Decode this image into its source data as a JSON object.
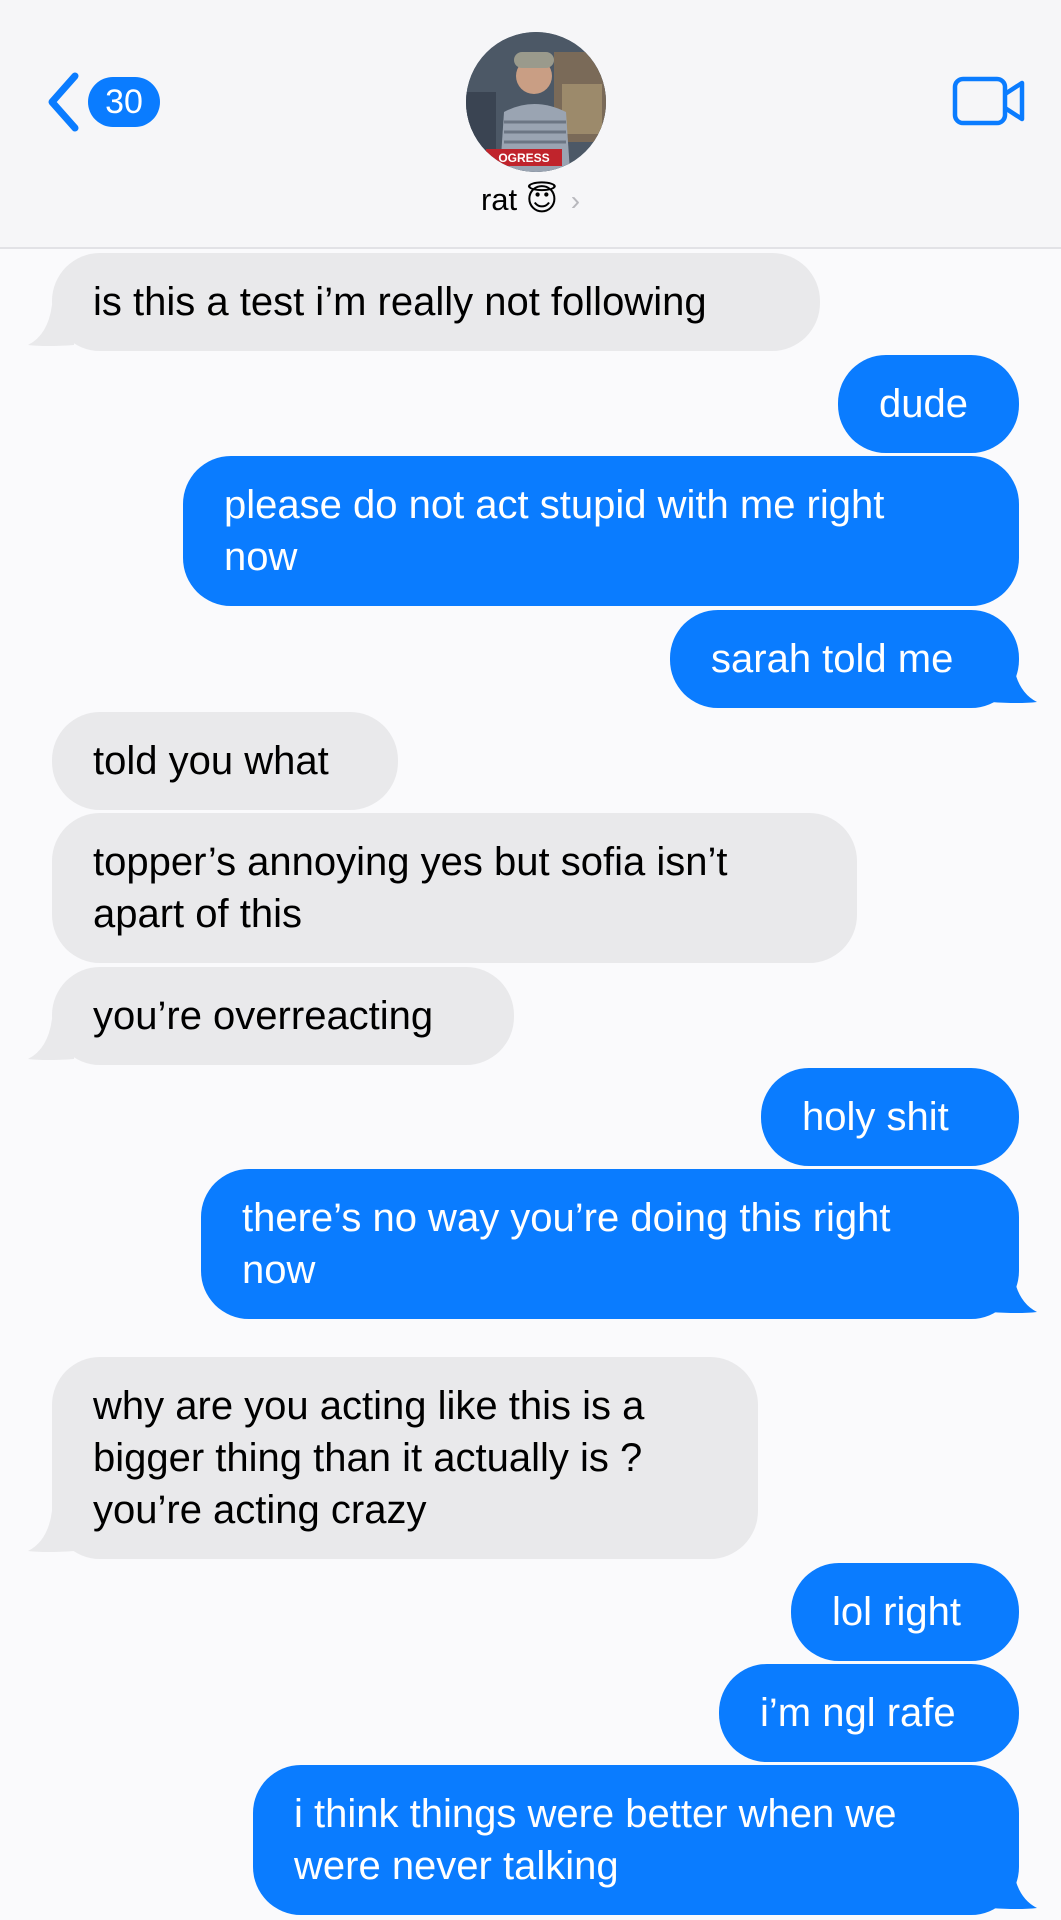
{
  "header": {
    "back_count": "30",
    "contact_name": "rat",
    "contact_emoji": "😇",
    "chevron": "›",
    "avatar_sign_text": "OGRESS",
    "back_icon": "chevron-left-icon",
    "video_icon": "video-camera-icon"
  },
  "colors": {
    "accent": "#0a7cff",
    "incoming_bubble": "#e9e9eb",
    "background": "#fafafc"
  },
  "messages": [
    {
      "from": "them",
      "lines": [
        "is this a test i’m really not following"
      ]
    },
    {
      "from": "me",
      "lines": [
        "dude"
      ]
    },
    {
      "from": "me",
      "lines": [
        "please do not act stupid with me right",
        "now"
      ]
    },
    {
      "from": "me",
      "lines": [
        "sarah told me"
      ]
    },
    {
      "from": "them",
      "lines": [
        "told you what"
      ]
    },
    {
      "from": "them",
      "lines": [
        "topper’s annoying yes but sofia isn’t",
        "apart of this"
      ]
    },
    {
      "from": "them",
      "lines": [
        "you’re overreacting"
      ]
    },
    {
      "from": "me",
      "lines": [
        "holy shit"
      ]
    },
    {
      "from": "me",
      "lines": [
        "there’s no way you’re doing this right",
        "now"
      ]
    },
    {
      "from": "them",
      "lines": [
        "why are you acting like this is a",
        "bigger thing than it actually is ?",
        "you’re acting crazy"
      ]
    },
    {
      "from": "me",
      "lines": [
        "lol right"
      ]
    },
    {
      "from": "me",
      "lines": [
        "i’m ngl rafe"
      ]
    },
    {
      "from": "me",
      "lines": [
        "i think things were better when we",
        "were never talking"
      ]
    }
  ]
}
